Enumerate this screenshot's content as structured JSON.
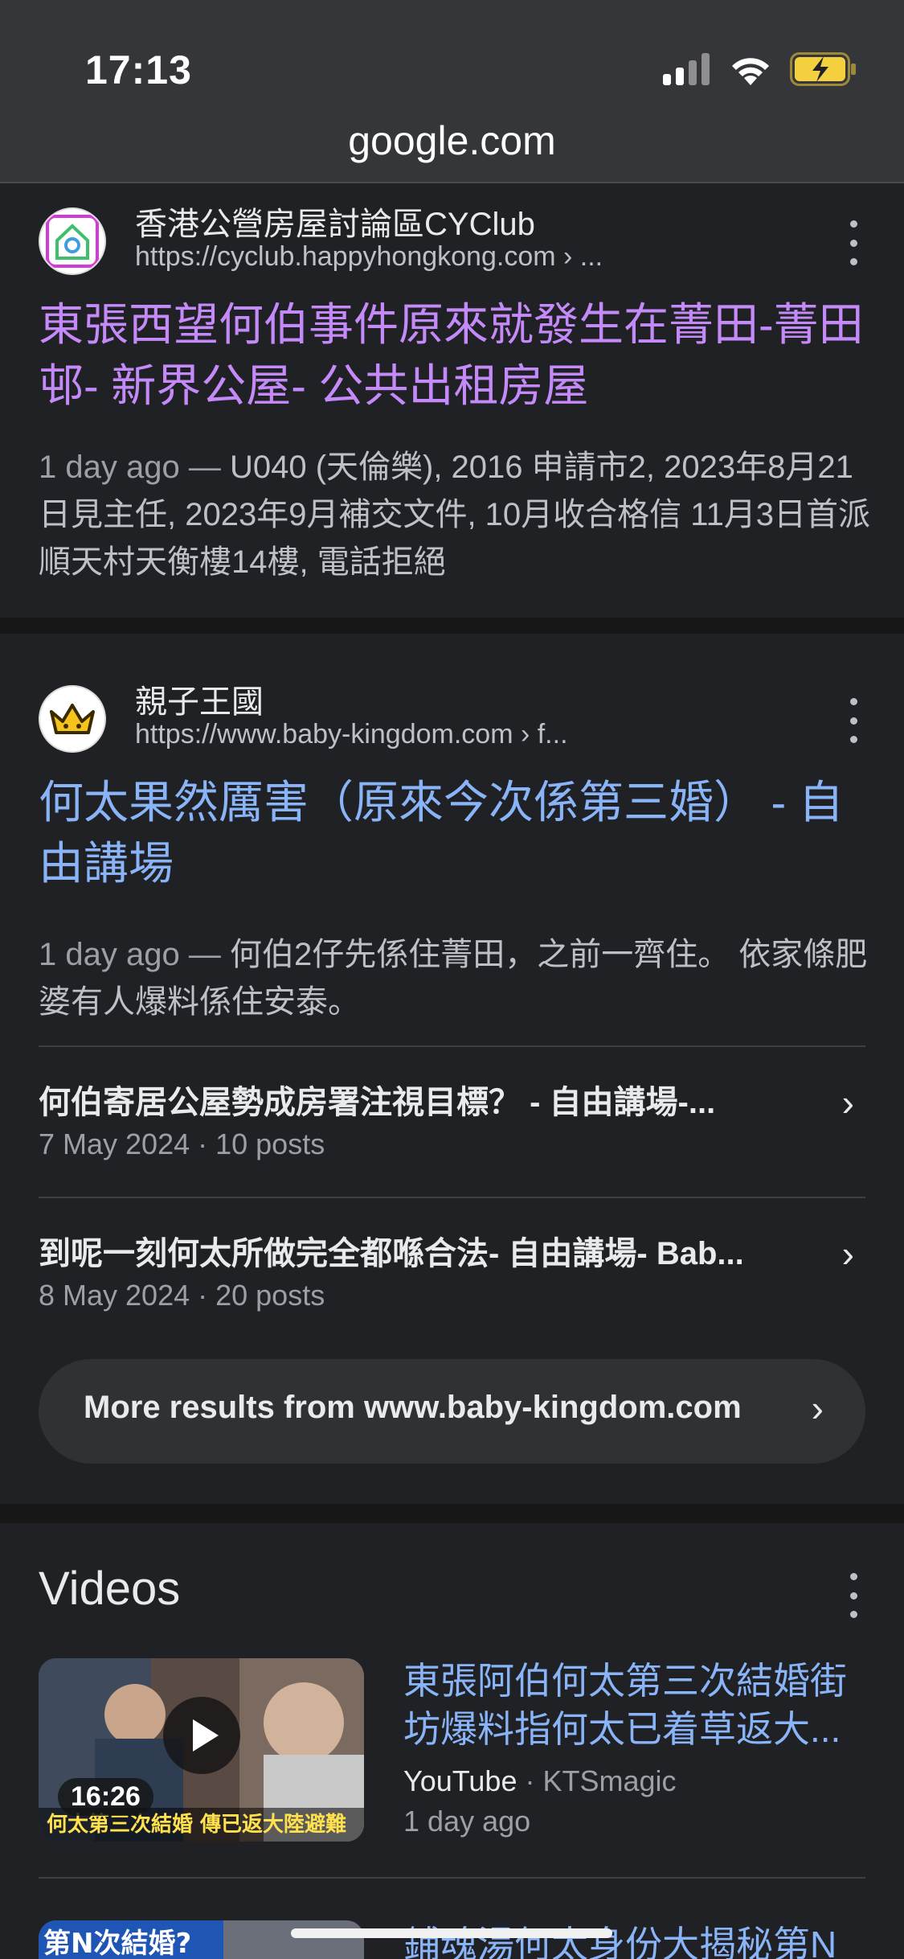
{
  "status_bar": {
    "time": "17:13"
  },
  "address_bar": {
    "url": "google.com"
  },
  "results": [
    {
      "site_name": "香港公營房屋討論區CYClub",
      "site_url": "https://cyclub.happyhongkong.com › ...",
      "title": "東張西望何伯事件原來就發生在菁田-菁田邨- 新界公屋- 公共出租房屋",
      "date": "1 day ago",
      "snippet": "U040 (天倫樂), 2016 申請市2, 2023年8月21日見主任, 2023年9月補交文件, 10月收合格信 11月3日首派順天村天衡樓14樓, 電話拒絕"
    },
    {
      "site_name": "親子王國",
      "site_url": "https://www.baby-kingdom.com › f...",
      "title": "何太果然厲害（原來今次係第三婚） - 自由講場",
      "date": "1 day ago",
      "snippet": "何伯2仔先係住菁田，之前一齊住。 依家條肥婆有人爆料係住安泰。",
      "sub_results": [
        {
          "title": "何伯寄居公屋勢成房署注視目標？ - 自由講場-...",
          "meta": "7 May 2024 · 10 posts"
        },
        {
          "title": "到呢一刻何太所做完全都喺合法- 自由講場- Bab...",
          "meta": "8 May 2024 · 20 posts"
        }
      ],
      "more_results": "More results from www.baby-kingdom.com"
    }
  ],
  "videos": {
    "heading": "Videos",
    "items": [
      {
        "title": "東張阿伯何太第三次結婚街坊爆料指何太已着草返大...",
        "source": "YouTube",
        "channel": "KTSmagic",
        "time": "1 day ago",
        "duration": "16:26",
        "thumb_text": "何太第三次結婚 傳已返大陸避難"
      },
      {
        "title": "鋪魂湯何太身份大揭秘第N",
        "thumb_text": "第N次結婚?"
      }
    ]
  },
  "colors": {
    "background": "#202124",
    "visited_link": "#c58af9",
    "link": "#8ab4f8",
    "battery": "#f4d03f"
  }
}
